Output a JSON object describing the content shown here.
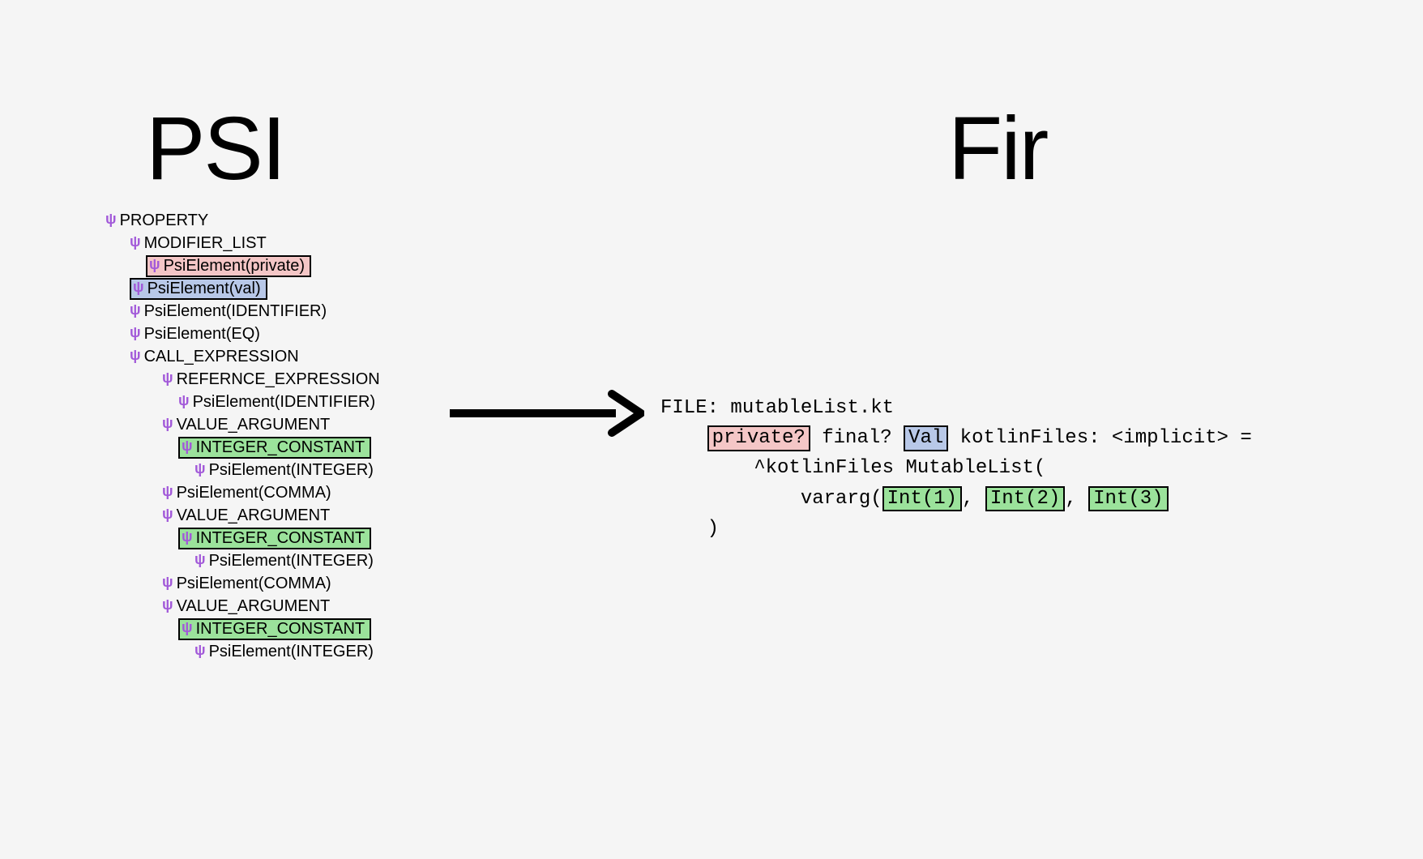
{
  "titles": {
    "psi": "PSI",
    "fir": "Fir"
  },
  "colors": {
    "pink": "#f4c6c6",
    "blue": "#b8c8e8",
    "green": "#9be29b"
  },
  "psi_tree": {
    "root": "PROPERTY",
    "modifier_list": "MODIFIER_LIST",
    "private_el": "PsiElement(private)",
    "val_el": "PsiElement(val)",
    "identifier_el": "PsiElement(IDENTIFIER)",
    "eq_el": "PsiElement(EQ)",
    "call_expr": "CALL_EXPRESSION",
    "ref_expr": "REFERNCE_EXPRESSION",
    "ref_identifier": "PsiElement(IDENTIFIER)",
    "value_arg": "VALUE_ARGUMENT",
    "int_const": "INTEGER_CONSTANT",
    "int_leaf": "PsiElement(INTEGER)",
    "comma_el": "PsiElement(COMMA)"
  },
  "fir": {
    "file_line": "FILE: mutableList.kt",
    "indent1": "    ",
    "private": "private?",
    "final": " final? ",
    "val": "Val",
    "decl_tail": " kotlinFiles: <implicit> =",
    "indent2": "        ",
    "caret_line": "^kotlinFiles MutableList(",
    "indent3": "            ",
    "vararg_lead": "vararg(",
    "int1": "Int(1)",
    "sep": ", ",
    "int2": "Int(2)",
    "int3": "Int(3)",
    "indent_close": "    ",
    "close": ")"
  }
}
